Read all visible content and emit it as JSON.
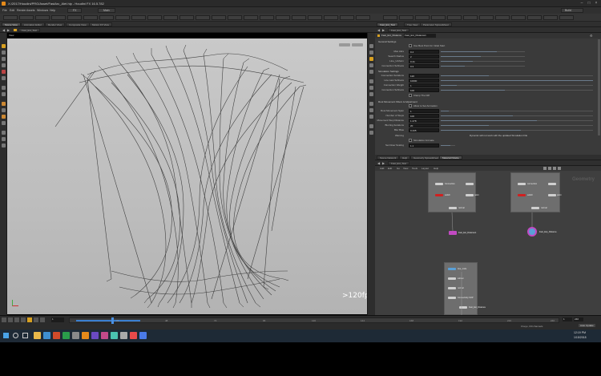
{
  "window": {
    "title": "X:/2017/Houdini/PRG/Asset/FastArc_Alet.hip - Houdini FX 16.5.782"
  },
  "menu": [
    "File",
    "Edit",
    "Render",
    "Assets",
    "Windows",
    "Help",
    "FX",
    "Main"
  ],
  "desktop_dropdown": "Build",
  "left_tabs": [
    "Scene View",
    "Animation Editor",
    "Render View",
    "Composite View",
    "Motion FX View"
  ],
  "path_label": "Fast_Ext_Test",
  "viewport_menu": "View",
  "fps": ">120fps",
  "right_top_tabs": [
    "Fast_Ext_Test",
    "Tree View",
    "Parameter Spreadsheet"
  ],
  "param_header": "Fast_Ext_Distance",
  "param_node_name": "Fast_Ext_Distance1",
  "params": {
    "general": "General Settings",
    "cb1": "Use Best Point for Initial Start",
    "max_attr": {
      "label": "Max Attrs",
      "value": "0.4"
    },
    "search_radius": {
      "label": "Search Radius",
      "value": "2"
    },
    "line_uniform": {
      "label": "Line_Uniform",
      "value": "0.41"
    },
    "connection_softness": {
      "label": "Connection Softness",
      "value": "0.3"
    },
    "simulation": "Simulation Settings",
    "connection_iterations": {
      "label": "Connection Iterations",
      "value": "120"
    },
    "line_last_softness": {
      "label": "Line Last Softness",
      "value": "10000"
    },
    "connection_weight": {
      "label": "Connection Weight",
      "value": "1"
    },
    "connection_softness2": {
      "label": "Connection Softness",
      "value": "100"
    },
    "cb2": "Clamp The Diff",
    "root_section": "Root Movement Filters & Adjustment",
    "cb3": "Allow to Set Animation",
    "root_movement_span": {
      "label": "Root Movement Span",
      "value": "1"
    },
    "number_of_steps": {
      "label": "Number of Steps",
      "value": "100"
    },
    "movement_step_distance": {
      "label": "Movement Step Distance",
      "value": "1.478"
    },
    "blurring_iterations": {
      "label": "Blurring Iterations",
      "value": "20"
    },
    "blur_bias": {
      "label": "Blur Bias",
      "value": "0.435"
    },
    "warning_label": "Warning",
    "warning_text": "Dynamic will not work with the updated Simulation File",
    "cb4": "Simulation Animate",
    "set_draw_scaling": {
      "label": "Set Draw Scaling",
      "value": "1.1"
    }
  },
  "net_tabs": [
    "Scene Network",
    "Help",
    "Geometry Spreadsheet",
    "Material Palette"
  ],
  "net_path": "Fast_Ext_Test",
  "net_menu": [
    "Add",
    "Edit",
    "Go",
    "View",
    "Tools",
    "Layout",
    "Help"
  ],
  "net_watermark": "Geometry",
  "nodes": {
    "box1": [
      "Connection",
      "null1",
      "switch",
      "point",
      "connectivity",
      "normal",
      "Fast_Ext_Distance1"
    ],
    "box2": [
      "connection",
      "switch",
      "point",
      "normal",
      "Fast_Exp_Distance"
    ],
    "box3": [
      "tree_node",
      "subnet",
      "normal",
      "Connectivity SOP",
      "Fast_Ext_Distance"
    ]
  },
  "timeline": {
    "frame": "1",
    "start": "1",
    "end": "240",
    "ticks": [
      "24",
      "48",
      "72",
      "96",
      "120",
      "144",
      "168",
      "192",
      "216",
      "240"
    ]
  },
  "status": {
    "keys": "0 keys, 0/0 channels",
    "auto_update": "Auto Update",
    "clock": "12:19 PM",
    "date": "1/15/2018"
  },
  "colors": {
    "accent": "#d8a020",
    "viewport_bg": "#c4c4c4",
    "red_flag": "#d02020",
    "node_blue": "#5aa0d8"
  }
}
